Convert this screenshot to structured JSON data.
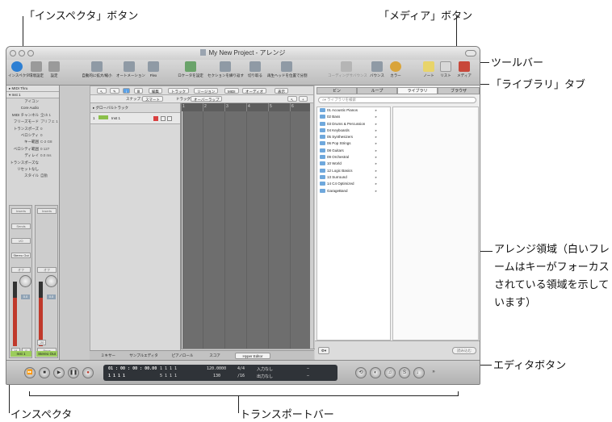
{
  "callouts": {
    "inspector_button": "「インスペクタ」ボタン",
    "media_button": "「メディア」ボタン",
    "toolbar": "ツールバー",
    "library_tab": "「ライブラリ」タブ",
    "arrange_area": "アレンジ領域（白いフレームはキーがフォーカスされている領域を示しています）",
    "editor_buttons": "エディタボタン",
    "inspector": "インスペクタ",
    "transport_bar": "トランスポートバー"
  },
  "window": {
    "title": "My New Project - アレンジ"
  },
  "toolbar": {
    "left": [
      {
        "label": "インスペクタ",
        "icon": "info-icon",
        "color": "#2d7fd3"
      },
      {
        "label": "環境設定",
        "icon": "preferences-icon",
        "color": "#9a9a9a"
      },
      {
        "label": "設定",
        "icon": "settings-icon",
        "color": "#9a9a9a"
      }
    ],
    "middle": [
      {
        "label": "自動的に拡大/縮小",
        "icon": "zoom-icon",
        "color": "#8f9aa5"
      },
      {
        "label": "オートメーション",
        "icon": "automation-icon",
        "color": "#8f9aa5"
      },
      {
        "label": "Flex",
        "icon": "flex-icon",
        "color": "#8f9aa5"
      },
      {
        "label": "ロケータを設定",
        "icon": "locator-icon",
        "color": "#6aa36a"
      },
      {
        "label": "セクションを繰り返す",
        "icon": "repeat-icon",
        "color": "#8f9aa5"
      },
      {
        "label": "切り取る",
        "icon": "cut-icon",
        "color": "#8f9aa5"
      },
      {
        "label": "再生ヘッドを位置で分割",
        "icon": "split-icon",
        "color": "#8f9aa5"
      }
    ],
    "right": [
      {
        "label": "コーディングサバウンス",
        "icon": "bounce-icon",
        "color": "#b5b5b5",
        "dim": true
      },
      {
        "label": "バウンス",
        "icon": "bounce-icon",
        "color": "#8f9aa5"
      },
      {
        "label": "カラー",
        "icon": "color-icon",
        "color": "#d9a43a"
      },
      {
        "label": "ノート",
        "icon": "note-icon",
        "color": "#e8d46a"
      },
      {
        "label": "リスト",
        "icon": "list-icon",
        "color": "#d8d8d8"
      },
      {
        "label": "メディア",
        "icon": "media-icon",
        "color": "#c8483a"
      }
    ]
  },
  "inspector": {
    "header1": "MIDI Thru",
    "header2": "Inst 1",
    "rows": [
      {
        "k": "アイコン",
        "v": ""
      },
      {
        "k": "Core Audio",
        "v": ""
      },
      {
        "k": "MIDI チャンネル",
        "v": "全ch 1"
      },
      {
        "k": "フリーズモード",
        "v": "プリフェ 1"
      },
      {
        "k": "トランスポーズ",
        "v": "0"
      },
      {
        "k": "ベロシティ",
        "v": "0"
      },
      {
        "k": "キー範囲",
        "v": "C-2 G8"
      },
      {
        "k": "ベロシティ範囲",
        "v": "0 127"
      },
      {
        "k": "ディレイ",
        "v": "0.0 ms"
      },
      {
        "k": "トランスポーズなし",
        "v": ""
      },
      {
        "k": "リセットなし",
        "v": ""
      },
      {
        "k": "スタイル",
        "v": "自動"
      }
    ],
    "strip1": {
      "inserts": "Inserts",
      "sends": "Sends",
      "io": "I/O",
      "output": "Stereo Out",
      "mode": "オフ",
      "level": "0.0",
      "name": "Inst 1",
      "mute": "M",
      "solo": "S"
    },
    "strip2": {
      "inserts": "Inserts",
      "mode": "オフ",
      "level": "0.0",
      "name": "Stereo Out",
      "value": "-20",
      "bnce": "Bnce"
    }
  },
  "arrange": {
    "menu": [
      "編集",
      "トラック",
      "リージョン",
      "MIDI",
      "オーディオ",
      "表示"
    ],
    "snap_label": "スナップ：",
    "snap_value": "スマート",
    "drag_label": "ドラッグ：",
    "drag_value": "オーバーラップ",
    "global_tracks": "グローバルトラック",
    "track_number": "1",
    "track_name": "Inst 1",
    "ruler": [
      "1",
      "2",
      "3",
      "4",
      "5",
      "6"
    ]
  },
  "media": {
    "tabs": [
      "ビン",
      "ループ",
      "ライブラリ",
      "ブラウザ"
    ],
    "active_tab": 2,
    "search_placeholder": "ライブラリを検索",
    "items": [
      "01 Acoustic Pianos",
      "02 Bass",
      "03 Drums & Percussion",
      "04 Keyboards",
      "05 Synthesizers",
      "06 Pop Strings",
      "08 Guitars",
      "09 Orchestral",
      "10 World",
      "12 Logic Basics",
      "13 Surround",
      "14 C4 Optimized",
      "GarageBand"
    ],
    "footer_right": "読み込む"
  },
  "editors": [
    "ミキサー",
    "サンプルエディタ",
    "ピアノロール",
    "スコア",
    "Hyper Editor"
  ],
  "transport": {
    "smpte_top": "01 : 00 : 00 : 00.00",
    "smpte_bottom": "1   1   1     1",
    "bars_top": "1   1   1     1",
    "bars_bottom": "5   1   1     1",
    "tempo": "120.0000",
    "division": "130",
    "sig_top": "4/4",
    "sig_bottom": "/16",
    "in_label": "入力なし",
    "out_label": "出力なし",
    "sign": "—"
  }
}
